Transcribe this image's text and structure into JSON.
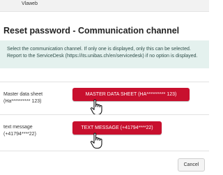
{
  "header": {
    "brand": "Vlaweb"
  },
  "page": {
    "title": "Reset password - Communication channel"
  },
  "info": {
    "message": "Select the communication channel. If only one is displayed, only this can be selected. Report to the ServiceDesk (https://its.unibas.ch/en/servicedesk) if no option is displayed."
  },
  "channels": [
    {
      "label_line1": "Master data sheet",
      "label_line2": "(Ha********** 123)",
      "button_label": "MASTER DATA SHEET (HA********** 123)"
    },
    {
      "label_line1": "text message",
      "label_line2": "(+41794****22)",
      "button_label": "TEXT MESSAGE (+41794****22)"
    }
  ],
  "footer": {
    "cancel_label": "Cancel"
  },
  "icons": {
    "cursor": "hand-pointer-icon"
  },
  "colors": {
    "primary": "#c8102e",
    "info_bg": "#e4f1ee"
  }
}
